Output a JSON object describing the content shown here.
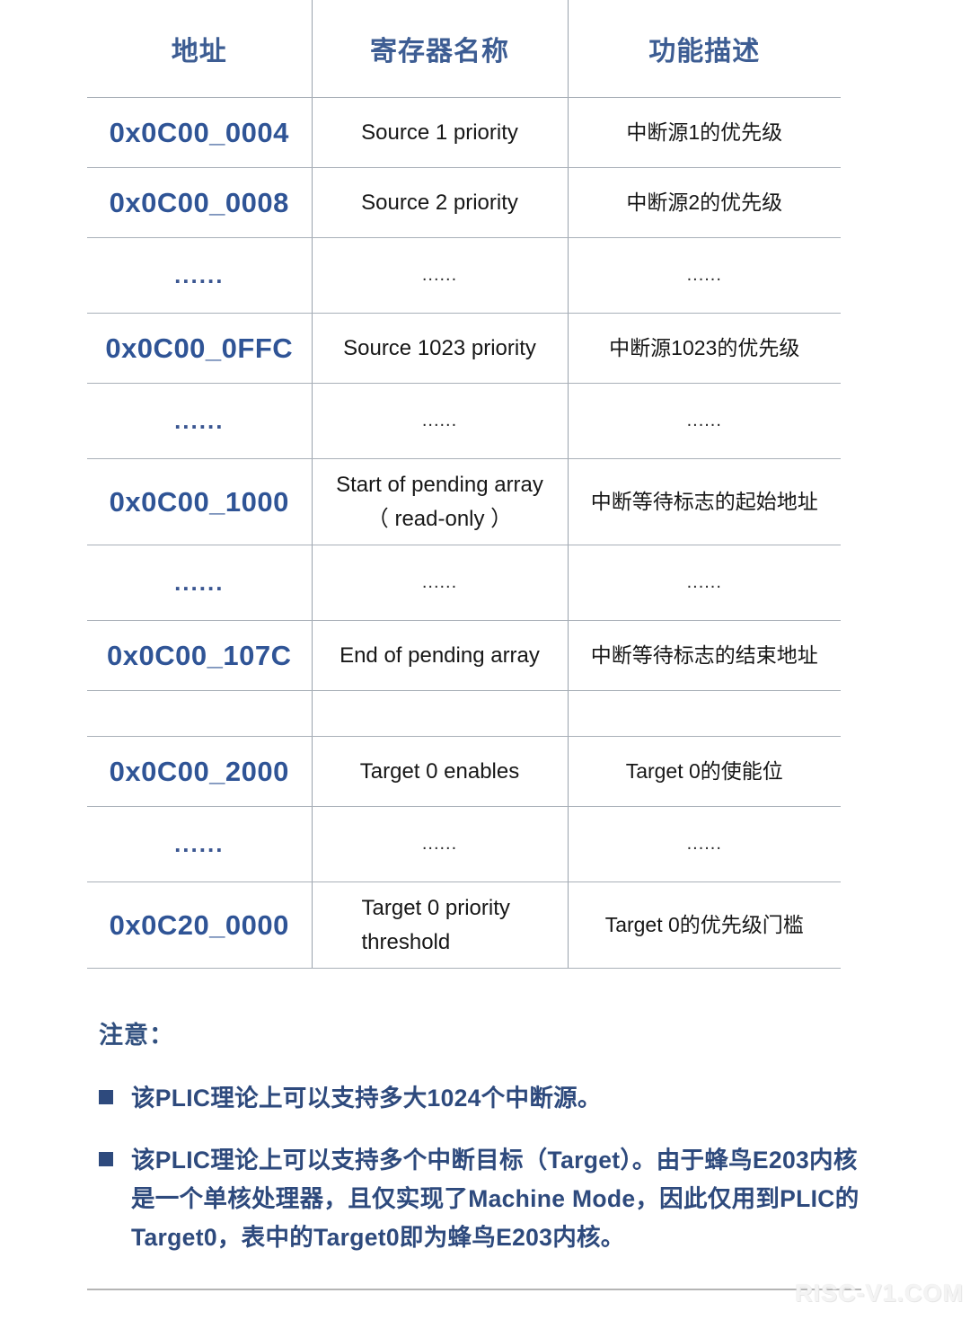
{
  "table": {
    "columns": [
      "地址",
      "寄存器名称",
      "功能描述"
    ],
    "rows": [
      {
        "type": "data",
        "addr": "0x0C00_0004",
        "name": "Source 1 priority",
        "desc": "中断源1的优先级"
      },
      {
        "type": "data",
        "addr": "0x0C00_0008",
        "name": "Source 2 priority",
        "desc": "中断源2的优先级"
      },
      {
        "type": "dots",
        "addr": "......",
        "name": "......",
        "desc": "......"
      },
      {
        "type": "data",
        "addr": "0x0C00_0FFC",
        "name": "Source 1023 priority",
        "desc": "中断源1023的优先级"
      },
      {
        "type": "dots",
        "addr": "......",
        "name": "......",
        "desc": "......"
      },
      {
        "type": "tall",
        "addr": "0x0C00_1000",
        "name": "Start of pending array",
        "name2": "（ read-only ）",
        "desc": "中断等待标志的起始地址"
      },
      {
        "type": "dots",
        "addr": "......",
        "name": "......",
        "desc": "......"
      },
      {
        "type": "data",
        "addr": "0x0C00_107C",
        "name": "End of pending array",
        "desc": "中断等待标志的结束地址"
      },
      {
        "type": "blank",
        "addr": "",
        "name": "",
        "desc": ""
      },
      {
        "type": "data",
        "addr": "0x0C00_2000",
        "name": "Target 0 enables",
        "desc": "Target 0的使能位"
      },
      {
        "type": "dots",
        "addr": "......",
        "name": "......",
        "desc": "......"
      },
      {
        "type": "tall",
        "addr": "0x0C20_0000",
        "name": "Target 0 priority",
        "name2": "threshold",
        "name_align": "left",
        "desc": "Target 0的优先级门槛"
      }
    ]
  },
  "notes": {
    "title": "注意：",
    "items": [
      "该PLIC理论上可以支持多大1024个中断源。",
      "该PLIC理论上可以支持多个中断目标（Target）。由于蜂鸟E203内核是一个单核处理器，且仅实现了Machine Mode，因此仅用到PLIC的Target0，表中的Target0即为蜂鸟E203内核。"
    ]
  },
  "footer": {
    "watermark": "RISC-V1.COM"
  },
  "colors": {
    "header_blue": "#3d5d93",
    "address_blue": "#2f5496",
    "note_blue": "#2e4a7d",
    "rule_gray": "#a9b0b8"
  }
}
